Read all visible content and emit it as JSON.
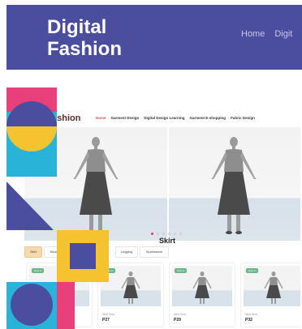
{
  "header": {
    "brand_line1": "Digital",
    "brand_line2": "Fashion",
    "nav": [
      "Home",
      "Digit"
    ]
  },
  "mock": {
    "logo": "ashion",
    "nav_links": [
      "Home",
      "Garment Design",
      "Digital Design Learning",
      "Garment E-shopping",
      "Fabric Design"
    ],
    "section_title": "Skirt",
    "tabs": [
      "Skirt",
      "Blou",
      "Legging",
      "Sportswear"
    ],
    "cards": [
      {
        "badge": "New In",
        "subtitle": "",
        "name": ""
      },
      {
        "badge": "New In",
        "subtitle": "New Skirt",
        "name": "P27"
      },
      {
        "badge": "New In",
        "subtitle": "New Skirt",
        "name": "P29"
      },
      {
        "badge": "New In",
        "subtitle": "New Skirt",
        "name": "P32"
      }
    ]
  },
  "colors": {
    "header_bg": "#4b4d9e",
    "pink": "#e8407a",
    "yellow": "#f5c330",
    "blue": "#4b4d9e",
    "cyan": "#2ab3d8",
    "active_link": "#d9534f"
  }
}
